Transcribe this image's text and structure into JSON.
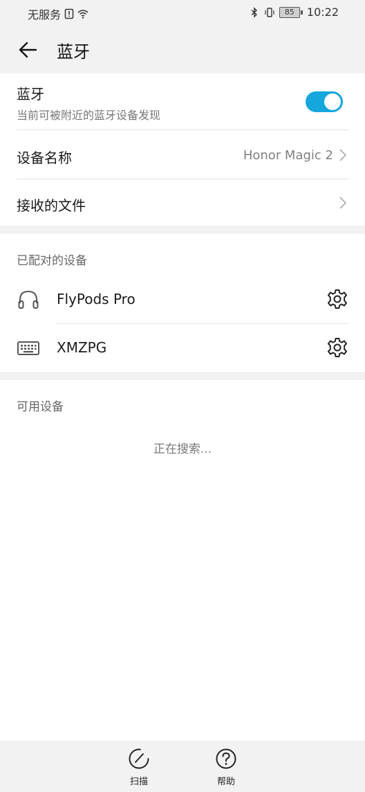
{
  "status_bar": {
    "carrier": "无服务",
    "battery": "85",
    "time": "10:22"
  },
  "appbar": {
    "title": "蓝牙",
    "back_icon": "arrow-left-icon"
  },
  "bluetooth": {
    "title": "蓝牙",
    "subtitle": "当前可被附近的蓝牙设备发现",
    "enabled": true,
    "accent_color": "#14a6dc"
  },
  "device_name": {
    "label": "设备名称",
    "value": "Honor Magic 2"
  },
  "received_files": {
    "label": "接收的文件"
  },
  "paired": {
    "header": "已配对的设备",
    "devices": [
      {
        "name": "FlyPods Pro",
        "icon": "headset-icon"
      },
      {
        "name": "XMZPG",
        "icon": "keyboard-icon"
      }
    ]
  },
  "available": {
    "header": "可用设备",
    "status": "正在搜索..."
  },
  "bottom_bar": {
    "scan_label": "扫描",
    "help_label": "帮助"
  }
}
